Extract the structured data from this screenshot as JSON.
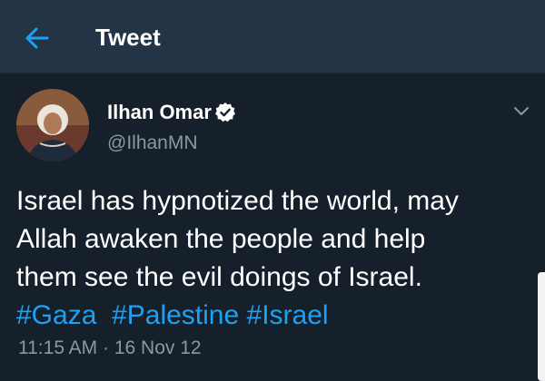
{
  "header": {
    "title": "Tweet",
    "back_icon": "arrow-left-icon"
  },
  "colors": {
    "background": "#15202b",
    "header_bg": "#243447",
    "accent": "#1da1f2",
    "secondary_text": "#8899a6"
  },
  "tweet": {
    "author_name": "Ilhan Omar",
    "verified_icon": "verified-badge-icon",
    "handle": "@IlhanMN",
    "menu_icon": "chevron-down-icon",
    "text_lines": [
      "Israel has hypnotized the world, may",
      "Allah awaken the people and help",
      "them see the evil doings of Israel."
    ],
    "hashtags": [
      "#Gaza",
      "#Palestine",
      "#Israel"
    ],
    "time": "11:15 AM",
    "separator": "·",
    "date": "16 Nov 12"
  }
}
